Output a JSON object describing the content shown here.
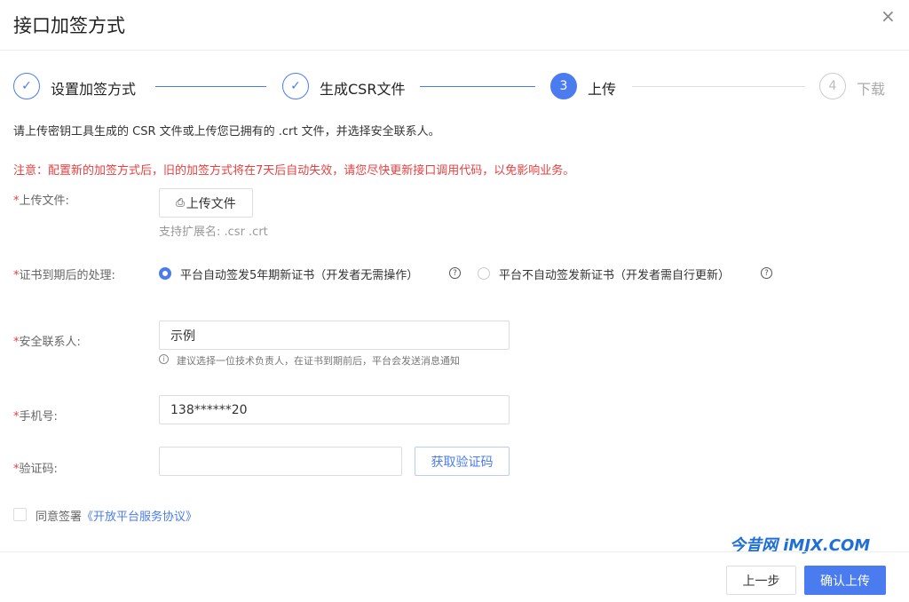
{
  "dialog": {
    "title": "接口加签方式",
    "close": "×"
  },
  "steps": [
    {
      "num": "✓",
      "label": "设置加签方式",
      "state": "done"
    },
    {
      "num": "✓",
      "label": "生成CSR文件",
      "state": "done"
    },
    {
      "num": "3",
      "label": "上传",
      "state": "active"
    },
    {
      "num": "4",
      "label": "下载",
      "state": "todo"
    }
  ],
  "instruction": "请上传密钥工具生成的 CSR 文件或上传您已拥有的 .crt 文件，并选择安全联系人。",
  "warning": "注意：配置新的加签方式后，旧的加签方式将在7天后自动失效，请您尽快更新接口调用代码，以免影响业务。",
  "form": {
    "required_mark": "*",
    "upload": {
      "label": "上传文件:",
      "button": "上传文件",
      "hint": "支持扩展名: .csr .crt"
    },
    "expiry": {
      "label": "证书到期后的处理:",
      "option1": "平台自动签发5年期新证书（开发者无需操作）",
      "option2": "平台不自动签发新证书（开发者需自行更新）",
      "selected": "option1"
    },
    "contact": {
      "label": "安全联系人:",
      "value": "示例",
      "hint": "建议选择一位技术负责人，在证书到期前后，平台会发送消息通知"
    },
    "phone": {
      "label": "手机号:",
      "value": "138******20"
    },
    "code": {
      "label": "验证码:",
      "value": "",
      "button": "获取验证码"
    },
    "agree": {
      "text": "同意签署",
      "link": "《开放平台服务协议》",
      "checked": false
    }
  },
  "watermark": "今昔网 iMJX.COM",
  "footer": {
    "prev": "上一步",
    "confirm": "确认上传"
  },
  "colors": {
    "primary": "#4a7cf0",
    "warning": "#e54040"
  }
}
